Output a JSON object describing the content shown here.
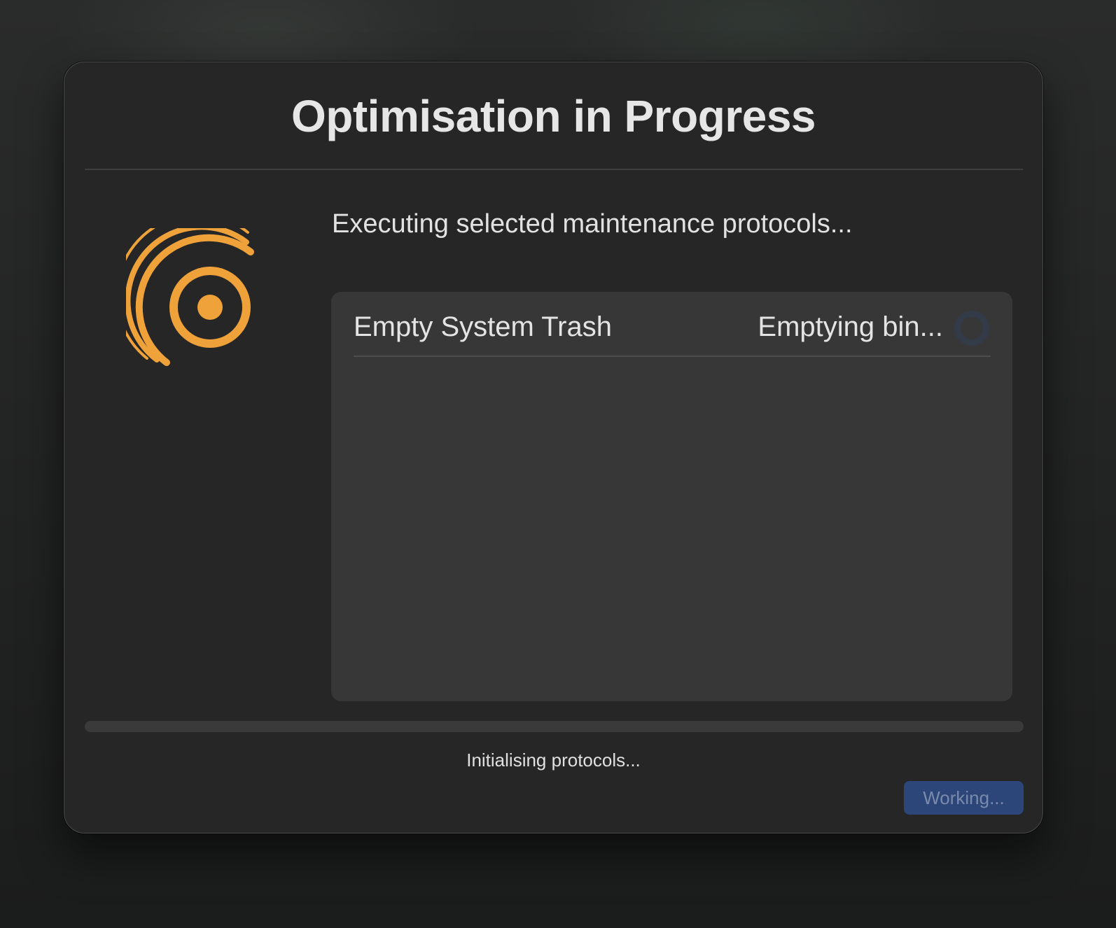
{
  "dialog": {
    "title": "Optimisation in Progress",
    "subtitle": "Executing selected maintenance protocols...",
    "logo_icon": "concentric-arcs-logo-icon",
    "accent_color": "#f0a23a"
  },
  "tasks": [
    {
      "name": "Empty System Trash",
      "status": "Emptying bin...",
      "status_icon": "spinner-icon"
    }
  ],
  "progress": {
    "fraction": 0.0,
    "status": "Initialising protocols..."
  },
  "footer": {
    "button_label": "Working...",
    "button_enabled": false,
    "button_color": "#2d4679"
  }
}
